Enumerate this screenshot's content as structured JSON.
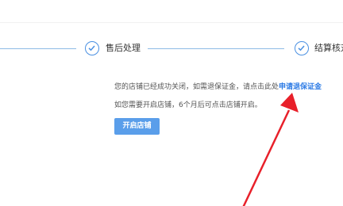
{
  "steps": [
    {
      "label": "售后处理",
      "status": "done"
    },
    {
      "label": "结算核对",
      "status": "done"
    }
  ],
  "notice": {
    "line1_prefix": "您的店铺已经成功关闭，如需退保证金，请点击此处",
    "line1_link": "申请退保证金",
    "line2": "如您需要开启店铺，6个月后可点击店铺开启。"
  },
  "actions": {
    "open_store": "开启店铺"
  },
  "colors": {
    "accent": "#4a90e2",
    "annotation_arrow": "#e8202a"
  }
}
